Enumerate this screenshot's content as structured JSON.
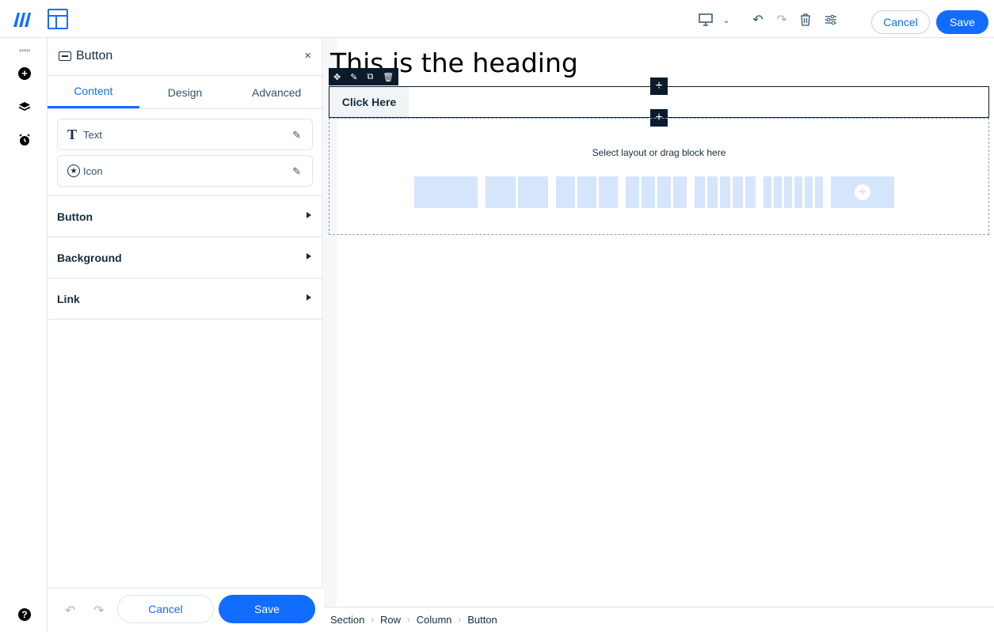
{
  "topbar": {
    "cancel_label": "Cancel",
    "save_label": "Save",
    "device": "desktop"
  },
  "panel": {
    "title": "Button",
    "close": "×",
    "tabs": [
      {
        "label": "Content",
        "active": true
      },
      {
        "label": "Design",
        "active": false
      },
      {
        "label": "Advanced",
        "active": false
      }
    ],
    "fields": [
      {
        "label": "Text",
        "icon": "text-icon"
      },
      {
        "label": "Icon",
        "icon": "star-icon"
      }
    ],
    "accordions": [
      "Button",
      "Background",
      "Link"
    ],
    "footer": {
      "cancel_label": "Cancel",
      "save_label": "Save"
    }
  },
  "canvas": {
    "heading": "This is the heading",
    "button_text": "Click Here",
    "drop_text": "Select layout or drag block here"
  },
  "breadcrumb": [
    "Section",
    "Row",
    "Column",
    "Button"
  ],
  "colors": {
    "accent": "#116dff",
    "layout_block": "#d5e5fb",
    "dark": "#0b1b2b"
  }
}
